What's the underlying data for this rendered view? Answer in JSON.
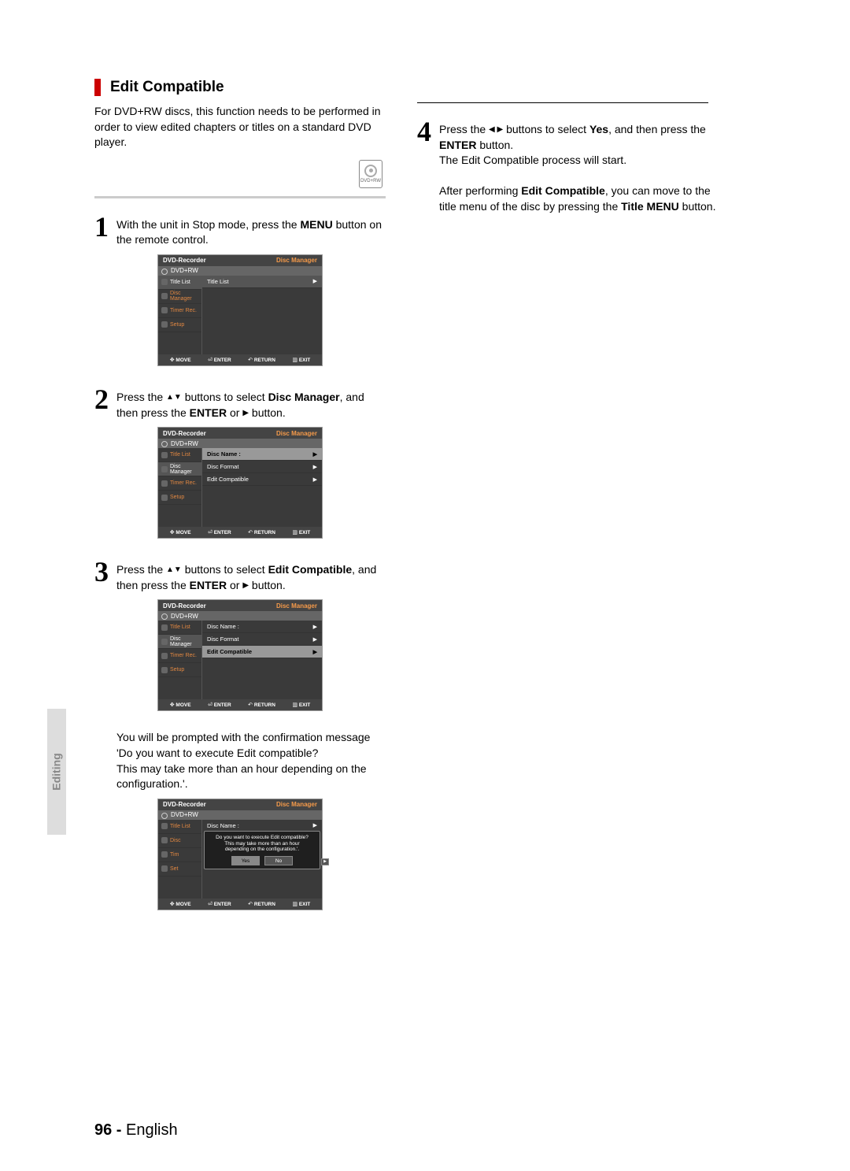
{
  "heading": "Edit Compatible",
  "intro": "For DVD+RW discs, this function needs to be performed in order to view edited chapters or titles on a standard DVD player.",
  "disc_icon_label": "DVD+RW",
  "steps": {
    "s1": {
      "num": "1",
      "prefix": "With the unit in Stop mode, press the ",
      "bold1": "MENU",
      "suffix": " button on the remote control."
    },
    "s2": {
      "num": "2",
      "t1": "Press the ",
      "t2": " buttons to select ",
      "bold1": "Disc Manager",
      "t3": ", and then press the ",
      "bold2": "ENTER",
      "t4": " or ",
      "t5": " button."
    },
    "s3": {
      "num": "3",
      "t1": "Press the ",
      "t2": " buttons to select ",
      "bold1": "Edit Compatible",
      "t3": ", and then press the ",
      "bold2": "ENTER",
      "t4": " or ",
      "t5": " button."
    },
    "s3_note": "You will be prompted with the confirmation message 'Do you want to execute Edit compatible?\nThis may take more than an hour depending on the configuration.'.",
    "s4": {
      "num": "4",
      "t1": "Press the ",
      "t2": " buttons to select ",
      "bold1": "Yes",
      "t3": ", and then press the ",
      "bold2": "ENTER",
      "t4": " button.",
      "line2": "The Edit Compatible process will start.",
      "after1": "After performing ",
      "after_b1": "Edit Compatible",
      "after2": ", you can move to the title menu of the disc by pressing the ",
      "after_b2": "Title MENU",
      "after3": " button."
    }
  },
  "osd": {
    "title_left": "DVD-Recorder",
    "title_right": "Disc Manager",
    "subtitle": "DVD+RW",
    "side": [
      "Title List",
      "Disc Manager",
      "Timer Rec.",
      "Setup"
    ],
    "main1": [
      "Title List"
    ],
    "main2": [
      "Disc Name :",
      "Disc Format",
      "Edit Compatible"
    ],
    "footer": {
      "move": "MOVE",
      "enter": "ENTER",
      "return": "RETURN",
      "exit": "EXIT"
    },
    "dialog": {
      "line1": "Do you want to execute Edit compatible?",
      "line2": "This may take more than an hour",
      "line3": "depending on the configuration.'.",
      "yes": "Yes",
      "no": "No"
    }
  },
  "side_label": "Editing",
  "page": {
    "num": "96 - ",
    "lang": "English"
  }
}
